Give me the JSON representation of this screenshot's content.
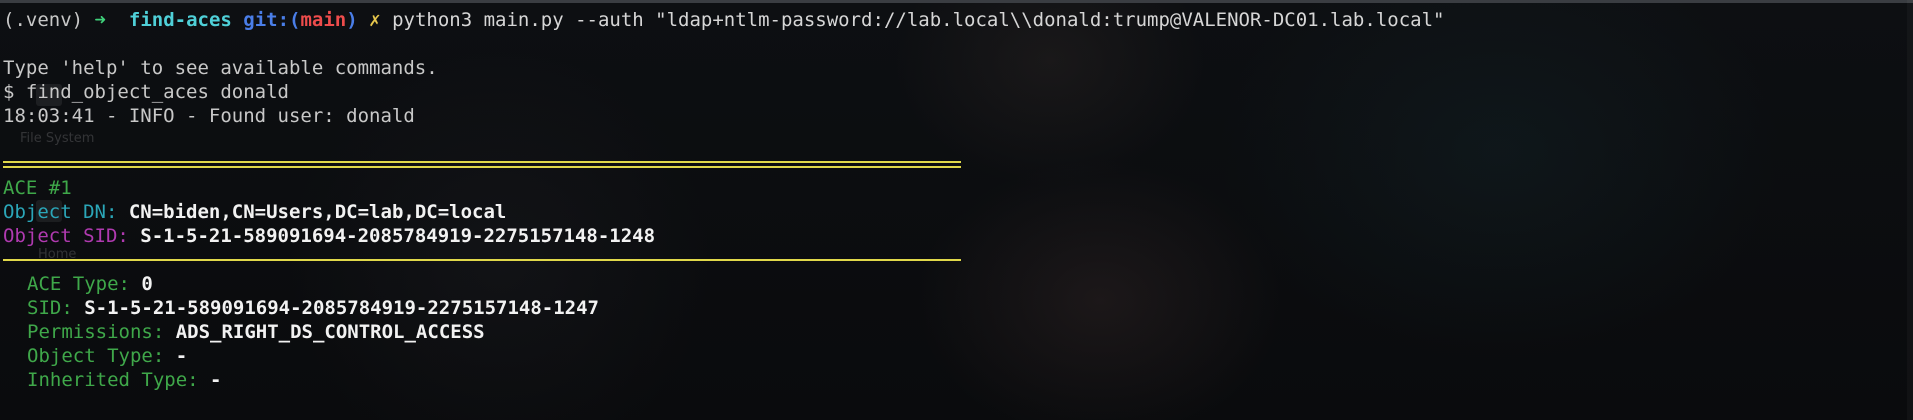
{
  "prompt": {
    "venv": "(.venv)",
    "arrow": "➜",
    "directory": "find-aces",
    "git_label": "git:(",
    "branch": "main",
    "git_close": ")",
    "dirty_marker": "✗",
    "command": "python3 main.py --auth \"ldap+ntlm-password://lab.local\\\\donald:trump@VALENOR-DC01.lab.local\""
  },
  "output": {
    "help_line": "Type 'help' to see available commands.",
    "input_prompt": "$ ",
    "input_command": "find_object_aces donald",
    "log_line": "18:03:41 - INFO - Found user: donald"
  },
  "ace": {
    "header": "ACE #1",
    "object_dn_label": "Object DN: ",
    "object_dn_value": "CN=biden,CN=Users,DC=lab,DC=local",
    "object_sid_label": "Object SID: ",
    "object_sid_value": "S-1-5-21-589091694-2085784919-2275157148-1248",
    "fields": [
      {
        "label": "ACE Type: ",
        "value": "0"
      },
      {
        "label": "SID: ",
        "value": "S-1-5-21-589091694-2085784919-2275157148-1247"
      },
      {
        "label": "Permissions: ",
        "value": "ADS_RIGHT_DS_CONTROL_ACCESS"
      },
      {
        "label": "Object Type: ",
        "value": "-"
      },
      {
        "label": "Inherited Type: ",
        "value": "-"
      }
    ]
  },
  "desktop_ghost": {
    "file_system_label": "File System",
    "home_label": "Home"
  },
  "colors": {
    "background": "#0b0d10",
    "rule": "#e0d84a",
    "green": "#3fa84a",
    "cyan": "#2ba6b8",
    "magenta": "#b03ab0"
  }
}
